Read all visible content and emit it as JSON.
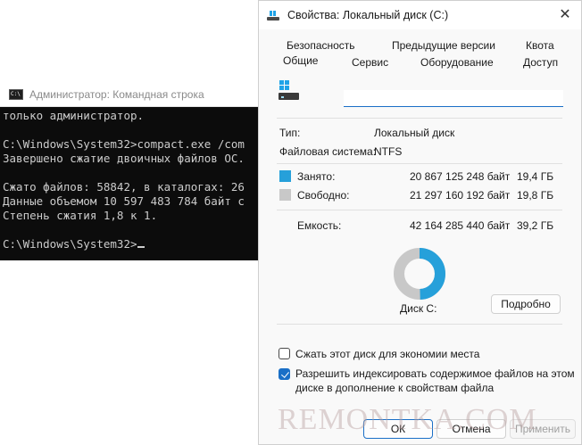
{
  "cmd": {
    "title": "Администратор: Командная строка",
    "lines": [
      "только администратор.",
      "",
      "C:\\Windows\\System32>compact.exe /com",
      "Завершено сжатие двоичных файлов ОС.",
      "",
      "Сжато файлов: 58842, в каталогах: 26",
      "Данные объемом 10 597 483 784 байт с",
      "Степень сжатия 1,8 к 1.",
      ""
    ],
    "prompt": "C:\\Windows\\System32>"
  },
  "dialog": {
    "title": "Свойства: Локальный диск (C:)",
    "close_label": "✕",
    "tabs": {
      "security": "Безопасность",
      "previous_versions": "Предыдущие версии",
      "quota": "Квота",
      "general": "Общие",
      "service": "Сервис",
      "hardware": "Оборудование",
      "access": "Доступ"
    },
    "drive_name_value": "",
    "type_label": "Тип:",
    "type_value": "Локальный диск",
    "fs_label": "Файловая система:",
    "fs_value": "NTFS",
    "used": {
      "label": "Занято:",
      "bytes": "20 867 125 248 байт",
      "gb": "19,4 ГБ",
      "color": "#26a0da"
    },
    "free": {
      "label": "Свободно:",
      "bytes": "21 297 160 192 байт",
      "gb": "19,8 ГБ",
      "color": "#c8c8c8"
    },
    "capacity": {
      "label": "Емкость:",
      "bytes": "42 164 285 440 байт",
      "gb": "39,2 ГБ"
    },
    "donut": {
      "used_fraction": 0.495
    },
    "disk_label": "Диск C:",
    "details_button": "Подробно",
    "compress_label": "Сжать этот диск для экономии места",
    "compress_checked": false,
    "index_label_line1": "Разрешить индексировать содержимое файлов на этом",
    "index_label_line2": "диске в дополнение к свойствам файла",
    "index_checked": true,
    "ok_button": "ОК",
    "cancel_button": "Отмена",
    "apply_button": "Применить"
  },
  "watermark": "REMONTKA.COM"
}
